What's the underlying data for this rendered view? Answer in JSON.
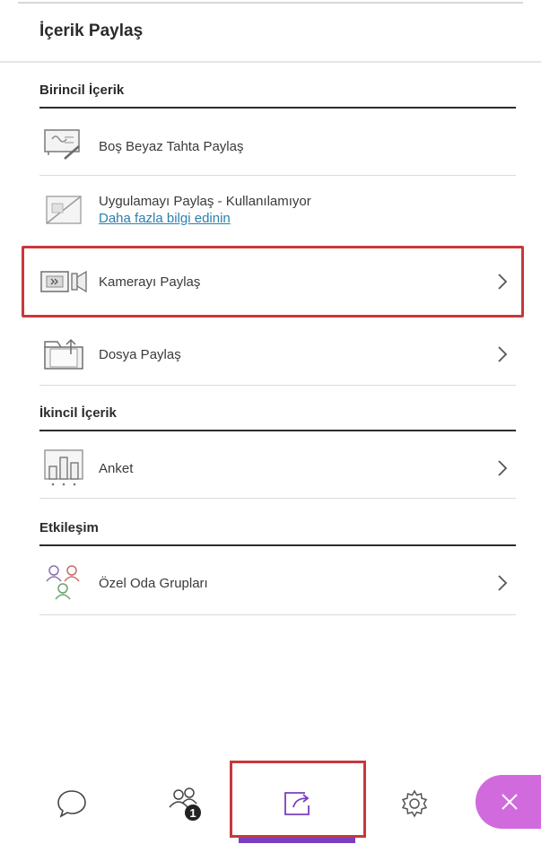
{
  "header": {
    "title": "İçerik Paylaş"
  },
  "sections": {
    "primary": {
      "title": "Birincil İçerik"
    },
    "secondary": {
      "title": "İkincil İçerik"
    },
    "interaction": {
      "title": "Etkileşim"
    }
  },
  "items": {
    "whiteboard": {
      "label": "Boş Beyaz Tahta Paylaş",
      "icon": "whiteboard-icon"
    },
    "app_share": {
      "label": "Uygulamayı Paylaş - Kullanılamıyor",
      "link": "Daha fazla bilgi edinin",
      "icon": "app-share-icon"
    },
    "camera": {
      "label": "Kamerayı Paylaş",
      "icon": "camera-icon"
    },
    "file": {
      "label": "Dosya Paylaş",
      "icon": "folder-icon"
    },
    "poll": {
      "label": "Anket",
      "icon": "poll-icon"
    },
    "breakout": {
      "label": "Özel Oda Grupları",
      "icon": "breakout-groups-icon"
    }
  },
  "bottom_nav": {
    "chat": {
      "icon": "chat-icon"
    },
    "attendees": {
      "icon": "attendees-icon",
      "badge": "1"
    },
    "share": {
      "icon": "share-content-icon",
      "active": true
    },
    "settings": {
      "icon": "gear-icon"
    },
    "close": {
      "icon": "close-icon"
    }
  },
  "colors": {
    "accent": "#7a3fc0",
    "highlight_box": "#c8383b",
    "close_fab": "#d16bdd",
    "link": "#2a7fb0"
  }
}
